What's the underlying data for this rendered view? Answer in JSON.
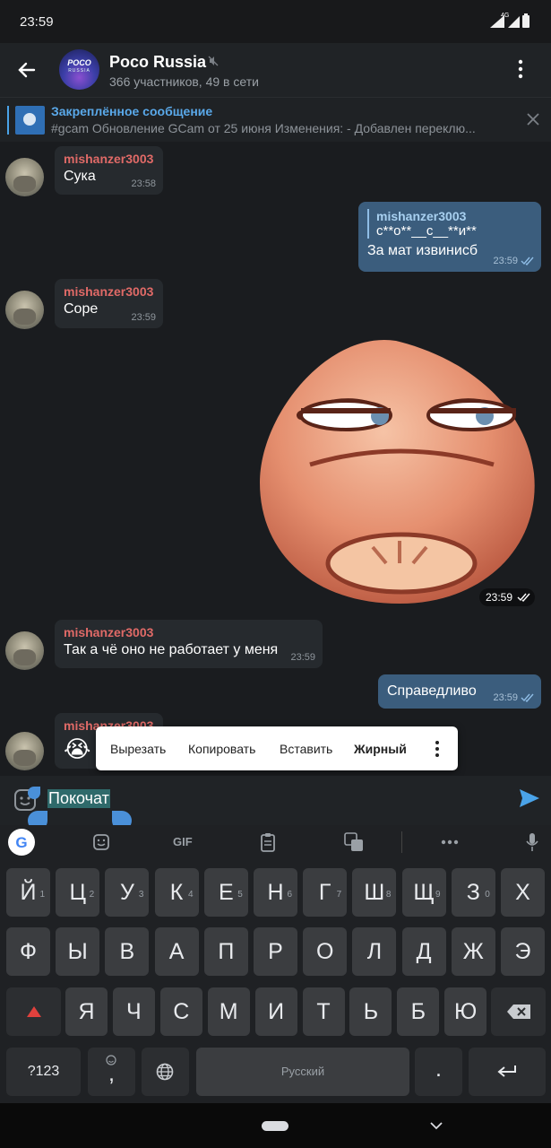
{
  "status": {
    "time": "23:59",
    "network": "4G"
  },
  "header": {
    "title": "Poco Russia",
    "subtitle": "366 участников, 49 в сети",
    "avatar_line1": "POCO",
    "avatar_line2": "RUSSIA"
  },
  "pinned": {
    "title": "Закреплённое сообщение",
    "text": "#gcam Обновление GCam от 25 июня  Изменения: - Добавлен переклю..."
  },
  "messages": [
    {
      "sender": "mishanzer3003",
      "text": "Сука",
      "time": "23:58"
    },
    {
      "reply_name": "mishanzer3003",
      "reply_text": "с**о**__с__**и**",
      "text": "За мат извинисб",
      "time": "23:59"
    },
    {
      "sender": "mishanzer3003",
      "text": "Cope",
      "time": "23:59"
    },
    {
      "sticker_time": "23:59"
    },
    {
      "sender": "mishanzer3003",
      "text": "Так а чё оно не работает у меня",
      "time": "23:59"
    },
    {
      "text": "Справедливо",
      "time": "23:59"
    },
    {
      "sender": "mishanzer3003",
      "text": "😭"
    }
  ],
  "context_menu": {
    "cut": "Вырезать",
    "copy": "Копировать",
    "paste": "Вставить",
    "bold": "Жирный"
  },
  "input": {
    "value": "Покочат"
  },
  "keyboard": {
    "toolbar": {
      "gif": "GIF"
    },
    "row1": [
      {
        "k": "Й",
        "h": "1"
      },
      {
        "k": "Ц",
        "h": "2"
      },
      {
        "k": "У",
        "h": "3"
      },
      {
        "k": "К",
        "h": "4"
      },
      {
        "k": "Е",
        "h": "5"
      },
      {
        "k": "Н",
        "h": "6"
      },
      {
        "k": "Г",
        "h": "7"
      },
      {
        "k": "Ш",
        "h": "8"
      },
      {
        "k": "Щ",
        "h": "9"
      },
      {
        "k": "З",
        "h": "0"
      },
      {
        "k": "Х",
        "h": ""
      }
    ],
    "row2": [
      "Ф",
      "Ы",
      "В",
      "А",
      "П",
      "Р",
      "О",
      "Л",
      "Д",
      "Ж",
      "Э"
    ],
    "row3": [
      "Я",
      "Ч",
      "С",
      "М",
      "И",
      "Т",
      "Ь",
      "Б",
      "Ю"
    ],
    "num_key": "?123",
    "comma": ",",
    "space": "Русский",
    "period": "."
  }
}
